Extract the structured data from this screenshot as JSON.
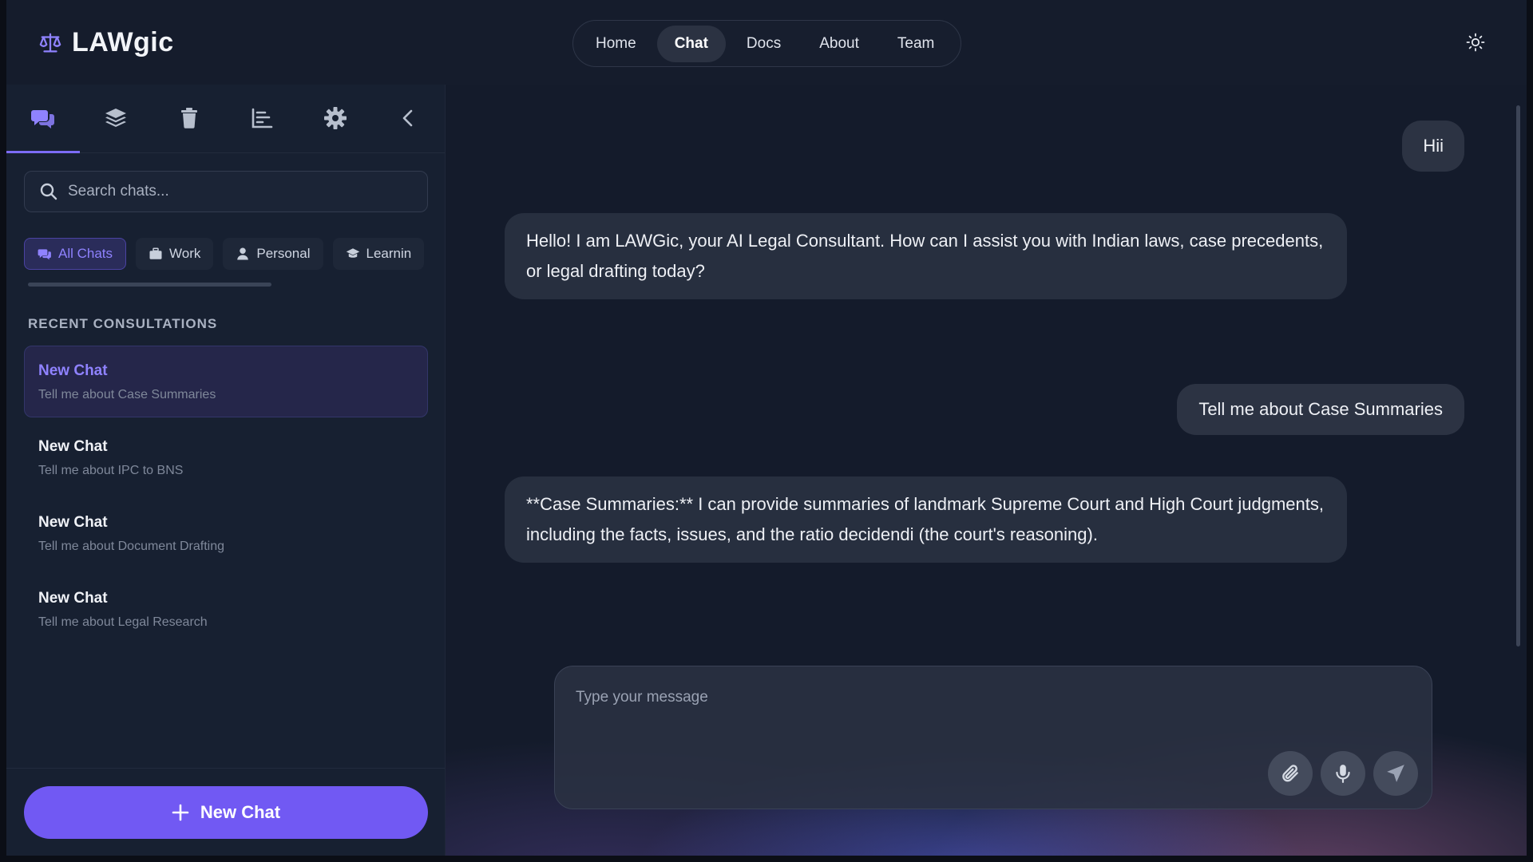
{
  "app": {
    "name": "LAWgic"
  },
  "nav": {
    "items": [
      {
        "label": "Home",
        "active": false
      },
      {
        "label": "Chat",
        "active": true
      },
      {
        "label": "Docs",
        "active": false
      },
      {
        "label": "About",
        "active": false
      },
      {
        "label": "Team",
        "active": false
      }
    ]
  },
  "sidebar": {
    "tabs": [
      "chats-icon",
      "layers-icon",
      "trash-icon",
      "chart-icon",
      "gear-icon",
      "chevron-left-icon"
    ],
    "search_placeholder": "Search chats...",
    "filters": [
      {
        "label": "All Chats",
        "icon": "chats-icon",
        "active": true
      },
      {
        "label": "Work",
        "icon": "briefcase-icon",
        "active": false
      },
      {
        "label": "Personal",
        "icon": "user-icon",
        "active": false
      },
      {
        "label": "Learnin",
        "icon": "graduation-cap-icon",
        "active": false
      }
    ],
    "section_title": "RECENT CONSULTATIONS",
    "chats": [
      {
        "title": "New Chat",
        "subtitle": "Tell me about Case Summaries",
        "active": true
      },
      {
        "title": "New Chat",
        "subtitle": "Tell me about IPC to BNS",
        "active": false
      },
      {
        "title": "New Chat",
        "subtitle": "Tell me about Document Drafting",
        "active": false
      },
      {
        "title": "New Chat",
        "subtitle": "Tell me about Legal Research",
        "active": false
      }
    ],
    "new_chat_label": "New Chat"
  },
  "messages": [
    {
      "role": "user",
      "text": "Hii"
    },
    {
      "role": "assistant",
      "text": "Hello! I am LAWGic, your AI Legal Consultant. How can I assist you with Indian laws, case precedents, or legal drafting today?"
    },
    {
      "role": "user",
      "text": "Tell me about Case Summaries"
    },
    {
      "role": "assistant",
      "text": "**Case Summaries:** I can provide summaries of landmark Supreme Court and High Court judgments, including the facts, issues, and the ratio decidendi (the court's reasoning)."
    }
  ],
  "composer": {
    "placeholder": "Type your message"
  },
  "colors": {
    "accent": "#7159f3",
    "accent_text": "#8f82ff",
    "background": "#141b2b"
  }
}
